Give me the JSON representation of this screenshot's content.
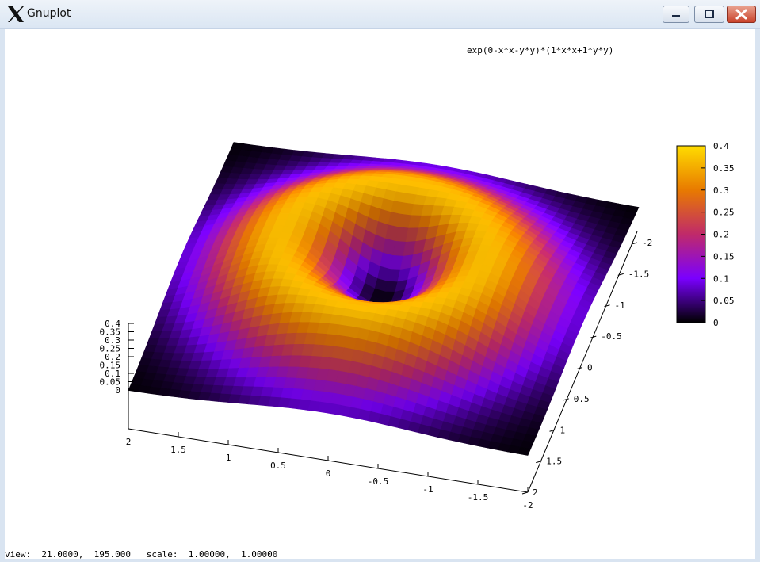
{
  "window": {
    "title": "Gnuplot",
    "buttons": [
      "minimize",
      "maximize",
      "close"
    ],
    "icon": "x-logo-icon"
  },
  "status": {
    "text": "view:  21.0000,  195.000   scale:  1.00000,  1.00000"
  },
  "chart_data": {
    "type": "surface",
    "title": "exp(0-x*x-y*y)*(1*x*x+1*y*y)",
    "function": "exp(-x*x-y*y)*(x*x+y*y)",
    "x_range": [
      -2,
      2
    ],
    "y_range": [
      -2,
      2
    ],
    "z_range": [
      0,
      0.4
    ],
    "view": {
      "rot_x": 21,
      "rot_z": 195
    },
    "palette": [
      "#000000",
      "#7a00ff",
      "#c02a6a",
      "#e87a00",
      "#ffdc00"
    ],
    "xtick_labels": [
      "2",
      "1.5",
      "1",
      "0.5",
      "0",
      "-0.5",
      "-1",
      "-1.5",
      "-2"
    ],
    "ytick_labels": [
      "-2",
      "-1.5",
      "-1",
      "-0.5",
      "0",
      "0.5",
      "1",
      "1.5",
      "2"
    ],
    "ztick_labels": [
      "0.4",
      "0.35",
      "0.3",
      "0.25",
      "0.2",
      "0.15",
      "0.1",
      "0.05",
      "0"
    ],
    "colorbar_labels": [
      "0.4",
      "0.35",
      "0.3",
      "0.25",
      "0.2",
      "0.15",
      "0.1",
      "0.05",
      "0"
    ],
    "colorbar_range": [
      0,
      0.4
    ]
  }
}
